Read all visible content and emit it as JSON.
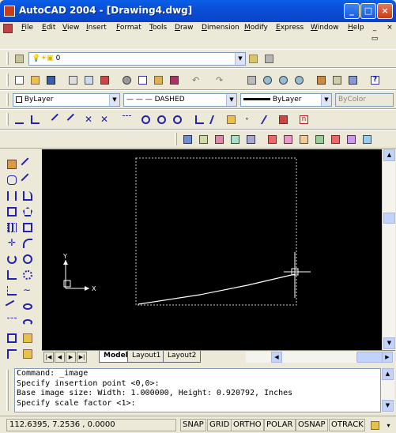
{
  "window": {
    "title": "AutoCAD 2004 - [Drawing4.dwg]"
  },
  "menu": {
    "items": [
      "File",
      "Edit",
      "View",
      "Insert",
      "Format",
      "Tools",
      "Draw",
      "Dimension",
      "Modify",
      "Express",
      "Window",
      "Help"
    ]
  },
  "toolbars": {
    "layer_value": "0",
    "color_value": "ByLayer",
    "linetype_value": "DASHED",
    "lineweight_value": "ByLayer",
    "plotstyle_value": "ByColor"
  },
  "tabs": {
    "nav_labels": [
      "|◀",
      "◀",
      "▶",
      "▶|"
    ],
    "items": [
      "Model",
      "Layout1",
      "Layout2"
    ],
    "active": "Model"
  },
  "ucs": {
    "x_label": "X",
    "y_label": "Y"
  },
  "command": {
    "lines": [
      "Command: _image",
      "Specify insertion point <0,0>:",
      "Base image size: Width: 1.000000, Height: 0.920792, Inches",
      "Specify scale factor <1>:"
    ]
  },
  "status": {
    "coordinates": "112.6395, 7.2536 , 0.0000",
    "toggles": [
      "SNAP",
      "GRID",
      "ORTHO",
      "POLAR",
      "OSNAP",
      "OTRACK"
    ]
  },
  "colors": {
    "titlebar": "#0b4fd8",
    "drawing_bg": "#000000",
    "chrome": "#ece9d8"
  }
}
